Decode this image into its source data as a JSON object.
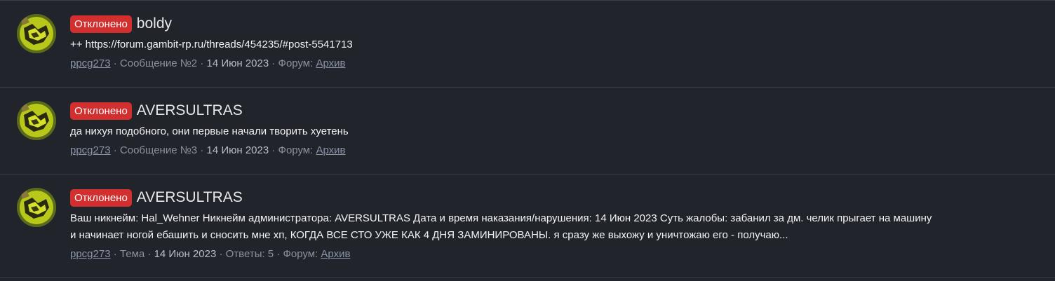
{
  "results": [
    {
      "badge": "Отклонено",
      "title": "boldy",
      "snippet": "++ https://forum.gambit-rp.ru/threads/454235/#post-5541713",
      "author": "ppcg273",
      "type": "Сообщение №2",
      "date": "14 Июн 2023",
      "forum_label": "Форум:",
      "forum": "Архив",
      "sep": "·"
    },
    {
      "badge": "Отклонено",
      "title": "AVERSULTRAS",
      "snippet": "да нихуя подобного, они первые начали творить хуетень",
      "author": "ppcg273",
      "type": "Сообщение №3",
      "date": "14 Июн 2023",
      "forum_label": "Форум:",
      "forum": "Архив",
      "sep": "·"
    },
    {
      "badge": "Отклонено",
      "title": "AVERSULTRAS",
      "snippet_line1": "Ваш никнейм: Hal_Wehner Никнейм администратора: AVERSULTRAS Дата и время наказания/нарушения: 14 Июн 2023 Суть жалобы: забанил за дм. челик прыгает на машину",
      "snippet_line2": "и начинает ногой ебашить и сносить мне хп, КОГДА ВСЕ СТО УЖЕ КАК 4 ДНЯ ЗАМИНИРОВАНЫ. я сразу же выхожу и уничтожаю его - получаю...",
      "author": "ppcg273",
      "type": "Тема",
      "date": "14 Июн 2023",
      "replies": "Ответы: 5",
      "forum_label": "Форум:",
      "forum": "Архив",
      "sep": "·"
    }
  ],
  "colors": {
    "background": "#22242b",
    "badge": "#d32f2f",
    "divider": "#3a3d45",
    "meta_text": "#8c919c"
  },
  "icons": {
    "avatar": "user-avatar-image"
  }
}
